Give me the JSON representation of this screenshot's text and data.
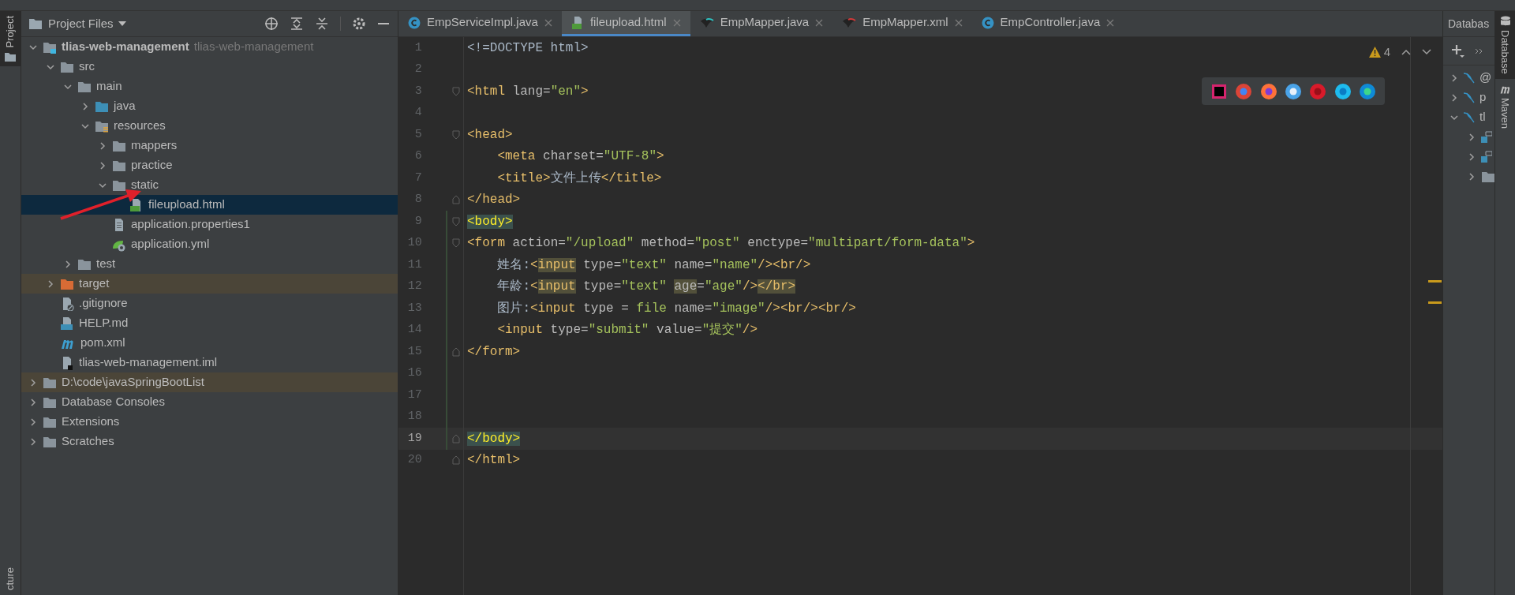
{
  "left_stripe": {
    "tabs": [
      {
        "label": "Project",
        "selected": true
      },
      {
        "label": "cture",
        "selected": false
      }
    ]
  },
  "project_panel": {
    "title": "Project Files",
    "tree": [
      {
        "label": "tlias-web-management",
        "secondary": "tlias-web-management",
        "kind": "module",
        "expanded": true,
        "selected": false,
        "excluded": false,
        "children": [
          {
            "label": "src",
            "kind": "folder",
            "expanded": true,
            "selected": false,
            "excluded": false,
            "children": [
              {
                "label": "main",
                "kind": "folder",
                "expanded": true,
                "selected": false,
                "excluded": false,
                "children": [
                  {
                    "label": "java",
                    "kind": "source",
                    "expanded": false,
                    "selected": false,
                    "excluded": false
                  },
                  {
                    "label": "resources",
                    "kind": "resources",
                    "expanded": true,
                    "selected": false,
                    "excluded": false,
                    "children": [
                      {
                        "label": "mappers",
                        "kind": "folder",
                        "expanded": false,
                        "selected": false,
                        "excluded": false
                      },
                      {
                        "label": "practice",
                        "kind": "folder",
                        "expanded": false,
                        "selected": false,
                        "excluded": false
                      },
                      {
                        "label": "static",
                        "kind": "folder",
                        "expanded": true,
                        "selected": false,
                        "excluded": false,
                        "children": [
                          {
                            "label": "fileupload.html",
                            "kind": "html",
                            "selected": true,
                            "excluded": false
                          }
                        ]
                      },
                      {
                        "label": "application.properties1",
                        "kind": "text",
                        "selected": false,
                        "excluded": false
                      },
                      {
                        "label": "application.yml",
                        "kind": "yml",
                        "selected": false,
                        "excluded": false
                      }
                    ]
                  }
                ]
              },
              {
                "label": "test",
                "kind": "folder",
                "expanded": false,
                "selected": false,
                "excluded": false
              }
            ]
          },
          {
            "label": "target",
            "kind": "excluded-folder",
            "expanded": false,
            "selected": false,
            "excluded": true
          },
          {
            "label": ".gitignore",
            "kind": "gitignore",
            "selected": false,
            "excluded": false
          },
          {
            "label": "HELP.md",
            "kind": "markdown",
            "selected": false,
            "excluded": false
          },
          {
            "label": "pom.xml",
            "kind": "maven",
            "selected": false,
            "excluded": false
          },
          {
            "label": "tlias-web-management.iml",
            "kind": "iml",
            "selected": false,
            "excluded": false
          }
        ]
      },
      {
        "label": "D:\\code\\javaSpringBootList",
        "kind": "folder",
        "expanded": false,
        "selected": false,
        "excluded": true
      },
      {
        "label": "Database Consoles",
        "kind": "folder",
        "expanded": false,
        "selected": false,
        "excluded": false
      },
      {
        "label": "Extensions",
        "kind": "folder",
        "expanded": false,
        "selected": false,
        "excluded": false
      },
      {
        "label": "Scratches",
        "kind": "folder",
        "expanded": false,
        "selected": false,
        "excluded": false
      }
    ]
  },
  "editor": {
    "tabs": [
      {
        "label": "EmpServiceImpl.java",
        "kind": "class",
        "selected": false
      },
      {
        "label": "fileupload.html",
        "kind": "html",
        "selected": true
      },
      {
        "label": "EmpMapper.java",
        "kind": "mybatis-java",
        "selected": false
      },
      {
        "label": "EmpMapper.xml",
        "kind": "mybatis-xml",
        "selected": false
      },
      {
        "label": "EmpController.java",
        "kind": "class",
        "selected": false
      }
    ],
    "warnings": "4",
    "lines": [
      {
        "number": "1",
        "fold_open": false,
        "fold_close": false,
        "current": false,
        "changed": false,
        "tokens": [
          {
            "text": "<!=DOCTYPE html>",
            "kind": "plain"
          }
        ]
      },
      {
        "number": "2",
        "fold_open": false,
        "fold_close": false,
        "current": false,
        "changed": false
      },
      {
        "number": "3",
        "fold_open": true,
        "fold_close": false,
        "current": false,
        "changed": false,
        "tokens": [
          {
            "text": "<html",
            "kind": "tag"
          },
          {
            "text": " lang=",
            "kind": "attr"
          },
          {
            "text": "\"en\"",
            "kind": "str"
          },
          {
            "text": ">",
            "kind": "tag"
          }
        ]
      },
      {
        "number": "4",
        "fold_open": false,
        "fold_close": false,
        "current": false,
        "changed": false
      },
      {
        "number": "5",
        "fold_open": true,
        "fold_close": false,
        "current": false,
        "changed": false,
        "tokens": [
          {
            "text": "<head>",
            "kind": "tag"
          }
        ]
      },
      {
        "number": "6",
        "fold_open": false,
        "fold_close": false,
        "current": false,
        "changed": false,
        "tokens": [
          {
            "text": "    <meta",
            "kind": "tag"
          },
          {
            "text": " charset=",
            "kind": "attr"
          },
          {
            "text": "\"UTF-8\"",
            "kind": "str"
          },
          {
            "text": ">",
            "kind": "tag"
          }
        ]
      },
      {
        "number": "7",
        "fold_open": false,
        "fold_close": false,
        "current": false,
        "changed": false,
        "tokens": [
          {
            "text": "    <title>",
            "kind": "tag"
          },
          {
            "text": "文件上传",
            "kind": "plain"
          },
          {
            "text": "</title>",
            "kind": "tag"
          }
        ]
      },
      {
        "number": "8",
        "fold_open": false,
        "fold_close": true,
        "current": false,
        "changed": false,
        "tokens": [
          {
            "text": "</head>",
            "kind": "tag"
          }
        ]
      },
      {
        "number": "9",
        "fold_open": true,
        "fold_close": false,
        "current": false,
        "changed": true,
        "tokens": [
          {
            "text": "<body>",
            "kind": "tag-paired"
          }
        ]
      },
      {
        "number": "10",
        "fold_open": true,
        "fold_close": false,
        "current": false,
        "changed": true,
        "tokens": [
          {
            "text": "<form",
            "kind": "tag"
          },
          {
            "text": " action=",
            "kind": "attr"
          },
          {
            "text": "\"/upload\"",
            "kind": "str"
          },
          {
            "text": " method=",
            "kind": "attr"
          },
          {
            "text": "\"post\"",
            "kind": "str"
          },
          {
            "text": " enctype=",
            "kind": "attr"
          },
          {
            "text": "\"multipart/form-data\"",
            "kind": "str"
          },
          {
            "text": ">",
            "kind": "tag"
          }
        ]
      },
      {
        "number": "11",
        "fold_open": false,
        "fold_close": false,
        "current": false,
        "changed": true,
        "tokens": [
          {
            "text": "    姓名:",
            "kind": "plain"
          },
          {
            "text": "<",
            "kind": "tag"
          },
          {
            "text": "input",
            "kind": "tag-warning"
          },
          {
            "text": " type=",
            "kind": "attr"
          },
          {
            "text": "\"text\"",
            "kind": "str"
          },
          {
            "text": " name=",
            "kind": "attr"
          },
          {
            "text": "\"name\"",
            "kind": "str"
          },
          {
            "text": "/><br/>",
            "kind": "tag"
          }
        ]
      },
      {
        "number": "12",
        "fold_open": false,
        "fold_close": false,
        "current": false,
        "changed": true,
        "tokens": [
          {
            "text": "    年龄:",
            "kind": "plain"
          },
          {
            "text": "<",
            "kind": "tag"
          },
          {
            "text": "input",
            "kind": "tag-warning"
          },
          {
            "text": " type=",
            "kind": "attr"
          },
          {
            "text": "\"text\" ",
            "kind": "str"
          },
          {
            "text": "age",
            "kind": "attr-warning"
          },
          {
            "text": "=",
            "kind": "attr"
          },
          {
            "text": "\"age\"",
            "kind": "str"
          },
          {
            "text": "/>",
            "kind": "tag"
          },
          {
            "text": "</br>",
            "kind": "tag-warning"
          }
        ]
      },
      {
        "number": "13",
        "fold_open": false,
        "fold_close": false,
        "current": false,
        "changed": true,
        "tokens": [
          {
            "text": "    图片:",
            "kind": "plain"
          },
          {
            "text": "<input",
            "kind": "tag"
          },
          {
            "text": " type = ",
            "kind": "attr"
          },
          {
            "text": "file",
            "kind": "str"
          },
          {
            "text": " name=",
            "kind": "attr"
          },
          {
            "text": "\"image\"",
            "kind": "str"
          },
          {
            "text": "/><br/><br/>",
            "kind": "tag"
          }
        ]
      },
      {
        "number": "14",
        "fold_open": false,
        "fold_close": false,
        "current": false,
        "changed": true,
        "tokens": [
          {
            "text": "    <input",
            "kind": "tag"
          },
          {
            "text": " type=",
            "kind": "attr"
          },
          {
            "text": "\"submit\"",
            "kind": "str"
          },
          {
            "text": " value=",
            "kind": "attr"
          },
          {
            "text": "\"提交\"",
            "kind": "str"
          },
          {
            "text": "/>",
            "kind": "tag"
          }
        ]
      },
      {
        "number": "15",
        "fold_open": false,
        "fold_close": true,
        "current": false,
        "changed": true,
        "tokens": [
          {
            "text": "</form>",
            "kind": "tag"
          }
        ]
      },
      {
        "number": "16",
        "fold_open": false,
        "fold_close": false,
        "current": false,
        "changed": true
      },
      {
        "number": "17",
        "fold_open": false,
        "fold_close": false,
        "current": false,
        "changed": true
      },
      {
        "number": "18",
        "fold_open": false,
        "fold_close": false,
        "current": false,
        "changed": true
      },
      {
        "number": "19",
        "fold_open": false,
        "fold_close": true,
        "current": true,
        "changed": true,
        "tokens": [
          {
            "text": "</body>",
            "kind": "tag-paired"
          }
        ]
      },
      {
        "number": "20",
        "fold_open": false,
        "fold_close": true,
        "current": false,
        "changed": false,
        "tokens": [
          {
            "text": "</html>",
            "kind": "tag"
          }
        ]
      }
    ]
  },
  "database_panel": {
    "title": "Databas",
    "tree": [
      {
        "label": "@",
        "kind": "mysql",
        "expanded": false
      },
      {
        "label": "p",
        "kind": "mysql",
        "expanded": false
      },
      {
        "label": "tl",
        "kind": "mysql",
        "expanded": true,
        "children": [
          {
            "kind": "schema",
            "expanded": false
          },
          {
            "kind": "schema",
            "expanded": false
          },
          {
            "kind": "folder",
            "expanded": false
          }
        ]
      }
    ]
  },
  "right_stripe": {
    "tabs": [
      {
        "label": "Database",
        "kind": "database",
        "selected": true
      },
      {
        "label": "Maven",
        "kind": "maven",
        "selected": false
      }
    ]
  }
}
